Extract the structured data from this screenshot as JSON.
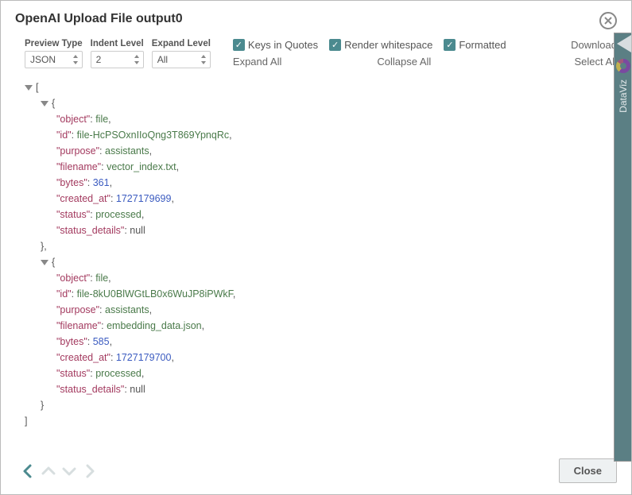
{
  "dialog": {
    "title": "OpenAI Upload File output0",
    "close_btn": "Close"
  },
  "controls": {
    "preview_type": {
      "label": "Preview Type",
      "value": "JSON"
    },
    "indent_level": {
      "label": "Indent Level",
      "value": "2"
    },
    "expand_level": {
      "label": "Expand Level",
      "value": "All"
    },
    "keys_in_quotes": {
      "label": "Keys in Quotes",
      "checked": true
    },
    "render_ws": {
      "label": "Render whitespace",
      "checked": true
    },
    "formatted": {
      "label": "Formatted",
      "checked": true
    },
    "expand_all": "Expand All",
    "collapse_all": "Collapse All",
    "download": "Download",
    "select_all": "Select All"
  },
  "sidebar": {
    "tab": "DataViz"
  },
  "json": [
    {
      "object": "file",
      "id": "file-HcPSOxnIIoQng3T869YpnqRc",
      "purpose": "assistants",
      "filename": "vector_index.txt",
      "bytes": 361,
      "created_at": 1727179699,
      "status": "processed",
      "status_details": null
    },
    {
      "object": "file",
      "id": "file-8kU0BlWGtLB0x6WuJP8iPWkF",
      "purpose": "assistants",
      "filename": "embedding_data.json",
      "bytes": 585,
      "created_at": 1727179700,
      "status": "processed",
      "status_details": null
    }
  ]
}
